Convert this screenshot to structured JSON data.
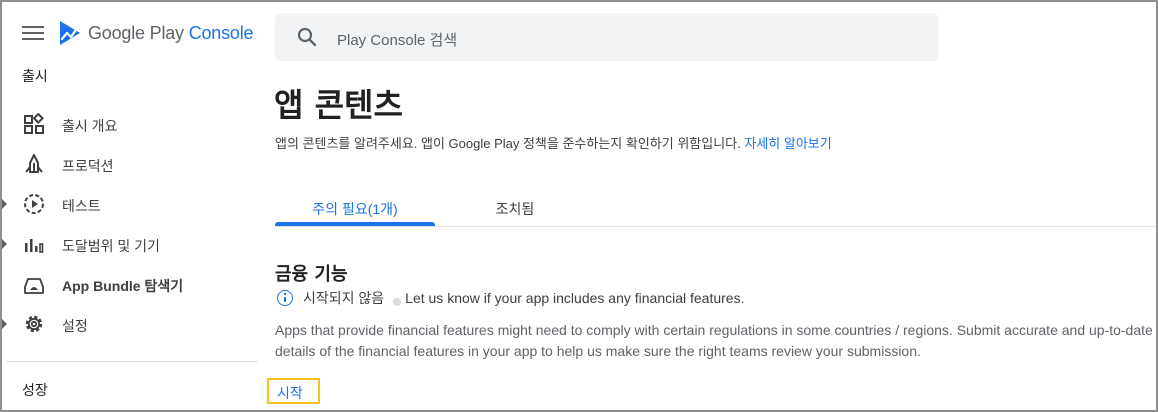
{
  "app": {
    "logo_text": "Google Play",
    "logo_text_accent": "Console"
  },
  "search": {
    "placeholder": "Play Console 검색"
  },
  "sidebar": {
    "section_release": "출시",
    "items": [
      {
        "label": "출시 개요",
        "icon": "dashboard-icon"
      },
      {
        "label": "프로덕션",
        "icon": "production-icon"
      },
      {
        "label": "테스트",
        "icon": "play-circle-icon"
      },
      {
        "label": "도달범위 및 기기",
        "icon": "bar-chart-icon"
      },
      {
        "label": "App Bundle 탐색기",
        "icon": "android-bundle-icon"
      },
      {
        "label": "설정",
        "icon": "gear-icon"
      }
    ],
    "section_growth": "성장"
  },
  "main": {
    "title": "앱 콘텐츠",
    "description": "앱의 콘텐츠를 알려주세요. 앱이 Google Play 정책을 준수하는지 확인하기 위함입니다.",
    "learn_more": "자세히 알아보기",
    "tabs": [
      {
        "label": "주의 필요(1개)",
        "active": true
      },
      {
        "label": "조치됨",
        "active": false
      }
    ],
    "section": {
      "title": "금융 기능",
      "status": "시작되지 않음",
      "status_note": "Let us know if your app includes any financial features.",
      "body": "Apps that provide financial features might need to comply with certain regulations in some countries / regions. Submit accurate and up-to-date details of the financial features in your app to help us make sure the right teams review your submission.",
      "start_label": "시작"
    }
  },
  "colors": {
    "accent": "#1a73e8",
    "highlight": "#f9c21b"
  }
}
